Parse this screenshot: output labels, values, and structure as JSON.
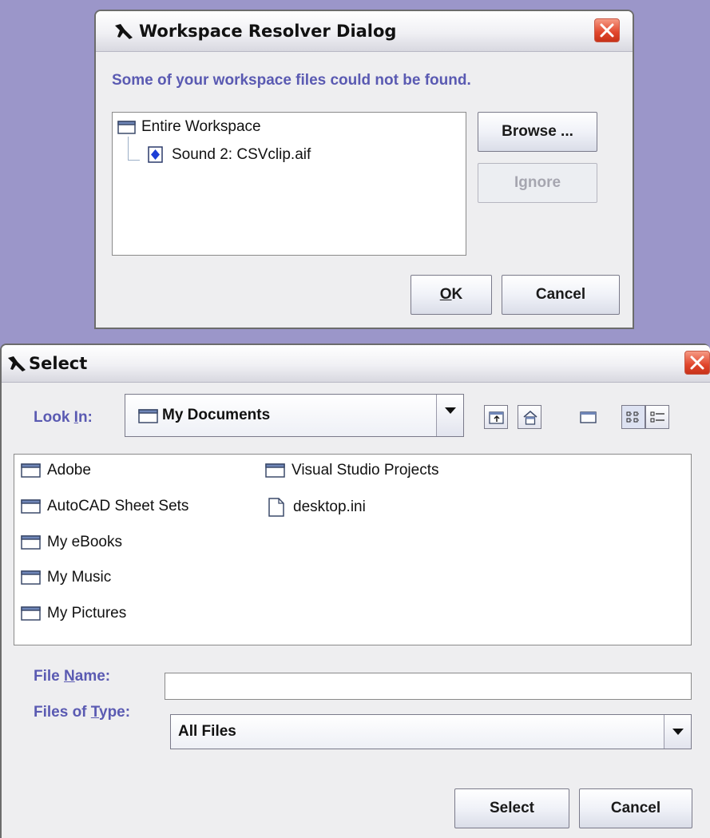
{
  "resolver": {
    "title": "Workspace Resolver Dialog",
    "message": "Some of your workspace files could not be found.",
    "tree": {
      "root": "Entire Workspace",
      "child": "Sound 2: CSVclip.aif"
    },
    "browse_label": "Browse ...",
    "ignore_label": "Ignore",
    "ok_mnemonic": "O",
    "ok_rest": "K",
    "cancel_label": "Cancel"
  },
  "select": {
    "title": "Select",
    "look_in_pre": "Look ",
    "look_in_mnemonic": "I",
    "look_in_post": "n:",
    "look_in_value": "My Documents",
    "toolbar_icons": [
      "up-one-level-icon",
      "home-icon",
      "new-folder-icon",
      "list-view-icon",
      "details-view-icon"
    ],
    "files": [
      {
        "name": "Adobe",
        "icon": "folder-icon"
      },
      {
        "name": "AutoCAD Sheet Sets",
        "icon": "folder-icon"
      },
      {
        "name": "My eBooks",
        "icon": "folder-icon"
      },
      {
        "name": "My Music",
        "icon": "folder-icon"
      },
      {
        "name": "My Pictures",
        "icon": "folder-icon"
      },
      {
        "name": "Visual Studio Projects",
        "icon": "folder-icon"
      },
      {
        "name": "desktop.ini",
        "icon": "file-icon"
      }
    ],
    "file_name_pre": "File ",
    "file_name_mnemonic": "N",
    "file_name_post": "ame:",
    "file_name_value": "",
    "files_of_type_pre": "Files of ",
    "files_of_type_mnemonic": "T",
    "files_of_type_post": "ype:",
    "files_of_type_value": "All Files",
    "select_label": "Select",
    "cancel_label": "Cancel"
  },
  "colors": {
    "desktop": "#9b96c9",
    "label_blue": "#5a5ab2",
    "close_red": "#e1462c"
  }
}
